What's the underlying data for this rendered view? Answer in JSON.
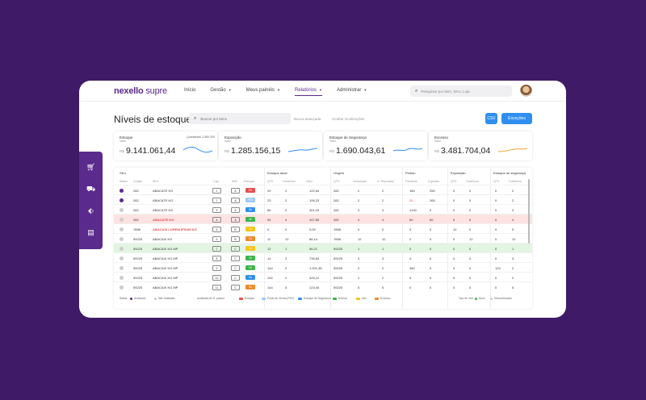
{
  "brand": {
    "logo_bold": "nexello",
    "logo_light": "supre"
  },
  "nav": {
    "items": [
      {
        "label": "Início",
        "dropdown": false,
        "active": false
      },
      {
        "label": "Gestão",
        "dropdown": true,
        "active": false
      },
      {
        "label": "Meus painéis",
        "dropdown": true,
        "active": false
      },
      {
        "label": "Relatórios",
        "dropdown": true,
        "active": true
      },
      {
        "label": "Administrar",
        "dropdown": true,
        "active": false
      }
    ]
  },
  "search": {
    "placeholder": "Pesquisar por item, SKU, Loja"
  },
  "page": {
    "title": "Níveis de estoque",
    "search_placeholder": "Buscar por itens",
    "advanced_search": "Busca avançada",
    "hide_locations": "Ocultar localizações",
    "csv_label": "CSV",
    "exceptions_label": "Exceções"
  },
  "kpis": [
    {
      "title": "Estoque",
      "subtitle": "Valor",
      "qty": "Quantidade 2.589.395",
      "currency": "R$",
      "value": "9.141.061,44",
      "color": "#2f8ff0"
    },
    {
      "title": "Exposição",
      "subtitle": "Valor",
      "qty": "",
      "currency": "R$",
      "value": "1.285.156,15",
      "color": "#2f8ff0"
    },
    {
      "title": "Estoque de Segurança",
      "subtitle": "Valor",
      "qty": "",
      "currency": "R$",
      "value": "1.690.043,61",
      "color": "#2f8ff0"
    },
    {
      "title": "Excesso",
      "subtitle": "Valor",
      "qty": "",
      "currency": "R$",
      "value": "3.481.704,04",
      "color": "#f0a030"
    }
  ],
  "table": {
    "groups": {
      "sku": "SKU",
      "estoque_atual": "Estoque atual",
      "origem": "Origem",
      "pedido": "Pedido",
      "exposicao": "Exposição",
      "estoque_seg": "Estoque de segurança"
    },
    "columns": {
      "status": "Status",
      "codigo": "Código",
      "sku": "SKU",
      "loja": "Loja",
      "abc": "ABC",
      "estoque": "Estoque",
      "qtd": "QTD",
      "cobertura": "Cobertura",
      "valor": "Valor",
      "qtd2": "QTD",
      "inmovacao": "Inmovação",
      "ult_reposicao": "Ú. Reposição",
      "pendente": "Pendente",
      "a_gerado": "A gerado",
      "qtd3": "QTD",
      "cobertura2": "Cobertura",
      "qtd4": "QTD",
      "cobertura3": "Cobertura"
    },
    "rows": [
      {
        "dot": true,
        "code": "282",
        "sku": "ABACATE KG",
        "loja": "1",
        "abc": "A",
        "tag": "ES",
        "tag_color": "#e84c4c",
        "q": "29",
        "cob": "2",
        "val": "122,64",
        "o1": "282",
        "o2": "2",
        "o3": "2",
        "p1": "160",
        "p2": "250",
        "e1": "0",
        "e2": "0",
        "s1": "0",
        "s2": "2",
        "hl": "",
        "skured": false,
        "p1red": false
      },
      {
        "dot": true,
        "code": "282",
        "sku": "ABACATE KG",
        "loja": "2",
        "abc": "A",
        "tag": "PDV",
        "tag_color": "#9ec8f5",
        "q": "23",
        "cob": "2",
        "val": "106,23",
        "o1": "282",
        "o2": "2",
        "o3": "2",
        "p1": "20",
        "p2": "265",
        "e1": "0",
        "e2": "0",
        "s1": "0",
        "s2": "2",
        "hl": "",
        "skured": false,
        "p1red": true
      },
      {
        "dot": false,
        "code": "282",
        "sku": "ABACATE KG",
        "loja": "3",
        "abc": "A",
        "tag": "Se",
        "tag_color": "#2f8ff0",
        "q": "86",
        "cob": "3",
        "val": "401,03",
        "o1": "282",
        "o2": "3",
        "o3": "3",
        "p1": "1240",
        "p2": "0",
        "e1": "0",
        "e2": "0",
        "s1": "0",
        "s2": "3",
        "hl": "",
        "skured": false,
        "p1red": false
      },
      {
        "dot": false,
        "code": "282",
        "sku": "ABACATE KG",
        "loja": "4",
        "abc": "A",
        "tag": "Nr",
        "tag_color": "#3cb54a",
        "q": "94",
        "cob": "4",
        "val": "447,65",
        "o1": "282",
        "o2": "4",
        "o3": "4",
        "p1": "60",
        "p2": "60",
        "e1": "0",
        "e2": "0",
        "s1": "0",
        "s2": "4",
        "hl": "red",
        "skured": true,
        "p1red": false
      },
      {
        "dot": false,
        "code": "7898",
        "sku": "ABACAXI LOREM IPSUM KG",
        "loja": "5",
        "abc": "B",
        "tag": "Al",
        "tag_color": "#f5c518",
        "q": "0",
        "cob": "0",
        "val": "0,00",
        "o1": "7898",
        "o2": "0",
        "o3": "0",
        "p1": "0",
        "p2": "0",
        "e1": "12",
        "e2": "0",
        "s1": "0",
        "s2": "0",
        "hl": "",
        "skured": true,
        "p1red": false
      },
      {
        "dot": false,
        "code": "59225",
        "sku": "ABACAXI KG",
        "loja": "6",
        "abc": "B",
        "tag": "Ex",
        "tag_color": "#f08a2a",
        "q": "11",
        "cob": "12",
        "val": "86,14",
        "o1": "7898",
        "o2": "12",
        "o3": "12",
        "p1": "0",
        "p2": "0",
        "e1": "0",
        "e2": "12",
        "s1": "0",
        "s2": "12",
        "hl": "",
        "skured": false,
        "p1red": false
      },
      {
        "dot": false,
        "code": "59225",
        "sku": "ABACAXI KG MP",
        "loja": "7",
        "abc": "C",
        "tag": "Al",
        "tag_color": "#f5c518",
        "q": "12",
        "cob": "1",
        "val": "56,21",
        "o1": "59225",
        "o2": "1",
        "o3": "1",
        "p1": "0",
        "p2": "0",
        "e1": "0",
        "e2": "0",
        "s1": "0",
        "s2": "1",
        "hl": "green",
        "skured": false,
        "p1red": false
      },
      {
        "dot": false,
        "code": "59225",
        "sku": "ABACAXI KG MP",
        "loja": "8",
        "abc": "C",
        "tag": "Nr",
        "tag_color": "#3cb54a",
        "q": "14",
        "cob": "3",
        "val": "735,84",
        "o1": "59225",
        "o2": "3",
        "o3": "3",
        "p1": "0",
        "p2": "0",
        "e1": "0",
        "e2": "0",
        "s1": "0",
        "s2": "3",
        "hl": "",
        "skured": false,
        "p1red": false
      },
      {
        "dot": false,
        "code": "59225",
        "sku": "ABACAXI KG MP",
        "loja": "9",
        "abc": "C",
        "tag": "Nr",
        "tag_color": "#3cb54a",
        "q": "144",
        "cob": "2",
        "val": "1.201,38",
        "o1": "59225",
        "o2": "2",
        "o3": "2",
        "p1": "360",
        "p2": "0",
        "e1": "0",
        "e2": "0",
        "s1": "124",
        "s2": "2",
        "hl": "",
        "skured": false,
        "p1red": false
      },
      {
        "dot": false,
        "code": "59225",
        "sku": "ABACAXI KG MP",
        "loja": "10",
        "abc": "C",
        "tag": "Se",
        "tag_color": "#2f8ff0",
        "q": "192",
        "cob": "2",
        "val": "325,12",
        "o1": "59225",
        "o2": "2",
        "o3": "2",
        "p1": "0",
        "p2": "0",
        "e1": "0",
        "e2": "0",
        "s1": "0",
        "s2": "2",
        "hl": "",
        "skured": false,
        "p1red": false
      },
      {
        "dot": false,
        "code": "59225",
        "sku": "ABACAXI KG MP",
        "loja": "11",
        "abc": "C",
        "tag": "Ex",
        "tag_color": "#f08a2a",
        "q": "144",
        "cob": "5",
        "val": "123,45",
        "o1": "59225",
        "o2": "5",
        "o3": "5",
        "p1": "0",
        "p2": "0",
        "e1": "0",
        "e2": "0",
        "s1": "0",
        "s2": "5",
        "hl": "",
        "skured": false,
        "p1red": false
      }
    ]
  },
  "legend": {
    "status_label": "Status",
    "analisado": "Analisado",
    "nao_analisado": "Não analisado",
    "estoque_label": "Analisado de E. possui:",
    "items": [
      {
        "label": "Estoque",
        "color": "#e84c4c"
      },
      {
        "label": "Ponto de Venda (PDV)",
        "color": "#9ec8f5"
      },
      {
        "label": "Estoque de Segurança",
        "color": "#2f8ff0"
      },
      {
        "label": "Normal",
        "color": "#3cb54a"
      },
      {
        "label": "Alto",
        "color": "#f5c518"
      },
      {
        "label": "Excesso",
        "color": "#f08a2a"
      }
    ],
    "ativo_label": "Tipo de Lido",
    "novo": "Novo",
    "descontinuado": "Descontinuado"
  }
}
